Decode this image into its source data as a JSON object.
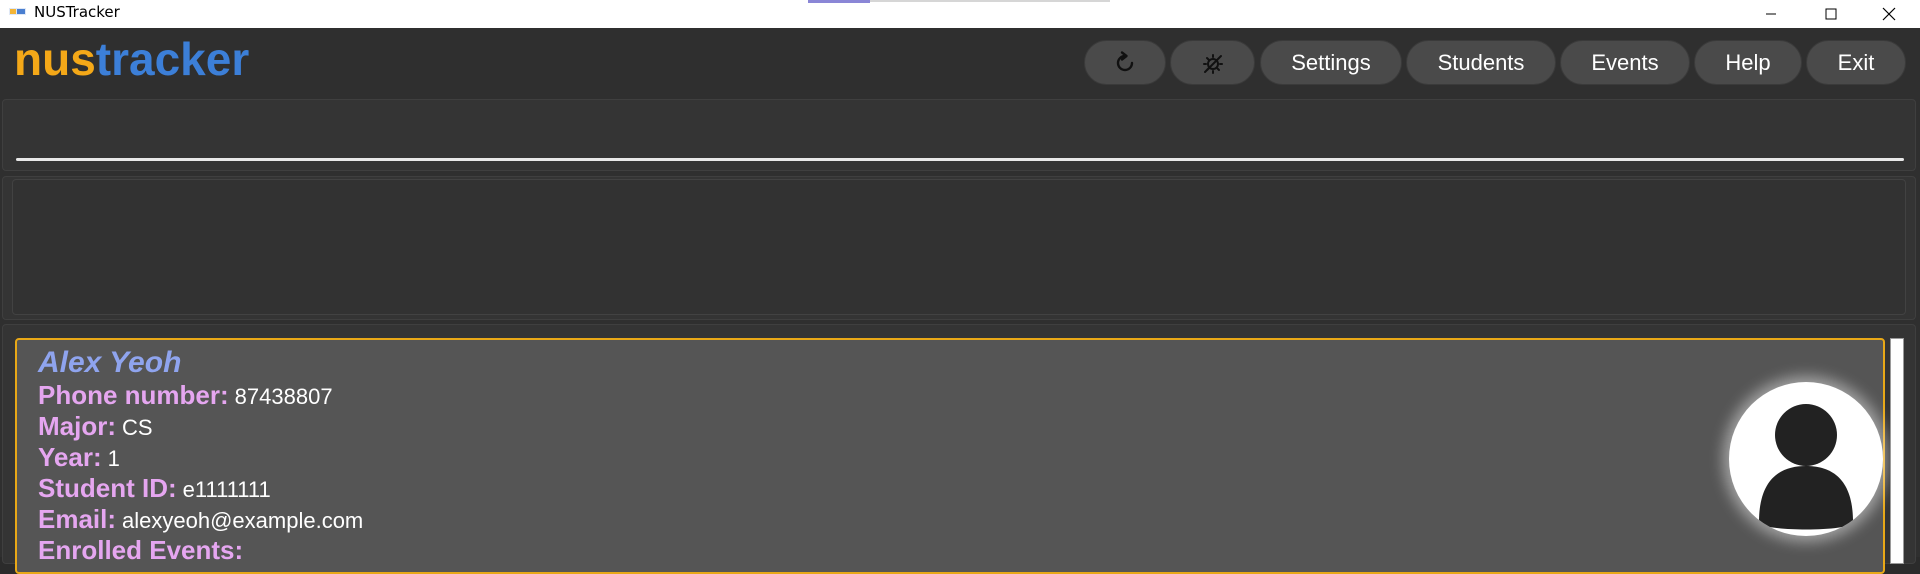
{
  "window": {
    "title": "NUSTracker"
  },
  "logo": {
    "part1": "nus",
    "part2": "tracker"
  },
  "toolbar": {
    "refresh_icon": "refresh-icon",
    "theme_icon": "theme-toggle-icon",
    "settings_label": "Settings",
    "students_label": "Students",
    "events_label": "Events",
    "help_label": "Help",
    "exit_label": "Exit"
  },
  "command": {
    "value": "",
    "placeholder": ""
  },
  "result": {
    "text": ""
  },
  "students": [
    {
      "name": "Alex Yeoh",
      "phone_label": "Phone number:",
      "phone": "87438807",
      "major_label": "Major:",
      "major": "CS",
      "year_label": "Year:",
      "year": "1",
      "student_id_label": "Student ID:",
      "student_id": "e1111111",
      "email_label": "Email:",
      "email": "alexyeoh@example.com",
      "enrolled_label": "Enrolled Events:",
      "enrolled": ""
    }
  ],
  "colors": {
    "accent_orange": "#f4a818",
    "accent_blue": "#3c7fd8",
    "card_border": "#e8a817",
    "name_color": "#8fa4ee",
    "label_color": "#e5a6f0"
  }
}
